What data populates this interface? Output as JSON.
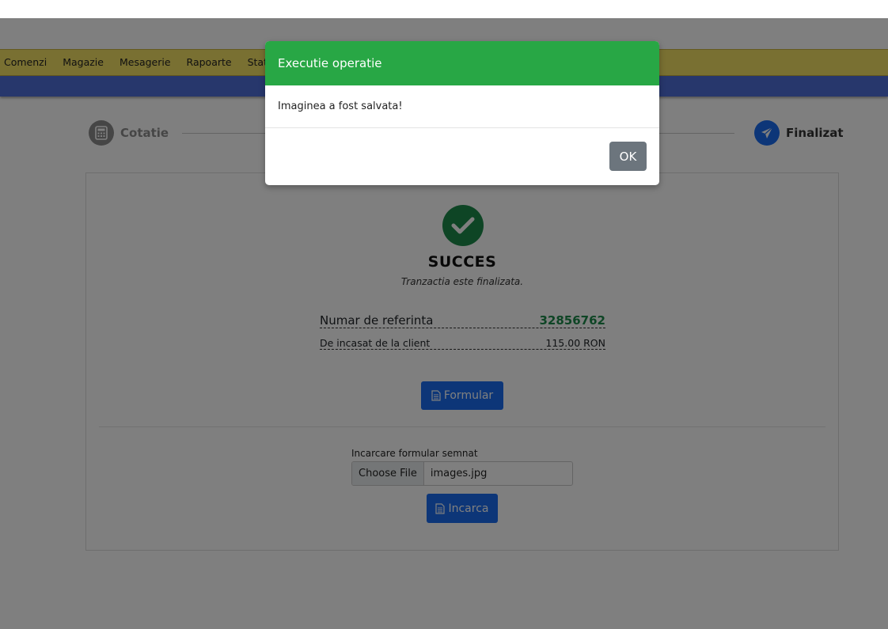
{
  "nav": {
    "items": [
      "Comenzi",
      "Magazie",
      "Mesagerie",
      "Rapoarte",
      "Statis"
    ]
  },
  "steps": {
    "first_label": "Cotatie",
    "last_label": "Finalizat"
  },
  "result": {
    "title": "SUCCES",
    "subtitle": "Tranzactia este finalizata.",
    "reference_label": "Numar de referinta",
    "reference_value": "32856762",
    "collect_label": "De incasat de la client",
    "collect_value": "115.00 RON"
  },
  "buttons": {
    "form_label": "Formular",
    "upload_label": "Incarca"
  },
  "upload": {
    "field_label": "Incarcare formular semnat",
    "choose_label": "Choose File",
    "file_name": "images.jpg"
  },
  "modal": {
    "title": "Executie operatie",
    "message": "Imaginea a fost salvata!",
    "ok_label": "OK"
  },
  "colors": {
    "success": "#28a745",
    "primary": "#1a6df0",
    "nav_yellow": "#f3e064",
    "nav_blue": "#4f6fd8"
  }
}
